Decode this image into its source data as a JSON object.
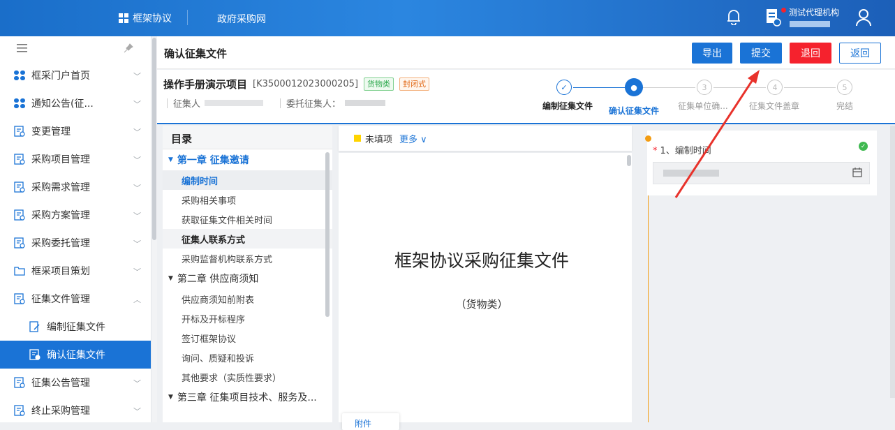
{
  "topbar": {
    "brand": "框架协议",
    "nav": "政府采购网",
    "user": "测试代理机构",
    "icons": [
      "grid-icon",
      "bell-icon",
      "document-icon",
      "user-icon"
    ]
  },
  "sidebar": {
    "items": [
      {
        "label": "框采门户首页",
        "icon": "grid-icon",
        "chevron": "﹀"
      },
      {
        "label": "通知公告(征...",
        "icon": "grid-icon",
        "chevron": "﹀"
      },
      {
        "label": "变更管理",
        "icon": "doc-list-icon",
        "chevron": "﹀"
      },
      {
        "label": "采购项目管理",
        "icon": "folder-gear-icon",
        "chevron": "﹀"
      },
      {
        "label": "采购需求管理",
        "icon": "doc-gear-icon",
        "chevron": "﹀"
      },
      {
        "label": "采购方案管理",
        "icon": "doc-gear-icon",
        "chevron": "﹀"
      },
      {
        "label": "采购委托管理",
        "icon": "doc-gear-icon",
        "chevron": "﹀"
      },
      {
        "label": "框采项目策划",
        "icon": "folder-icon",
        "chevron": "﹀"
      },
      {
        "label": "征集文件管理",
        "icon": "doc-gear-icon",
        "chevron": "︿"
      },
      {
        "label": "编制征集文件",
        "icon": "edit-doc-icon",
        "sub": true
      },
      {
        "label": "确认征集文件",
        "icon": "doc-gear-icon",
        "sub": true,
        "active": true
      },
      {
        "label": "征集公告管理",
        "icon": "doc-gear-icon",
        "chevron": "﹀"
      },
      {
        "label": "终止采购管理",
        "icon": "doc-stop-icon",
        "chevron": "﹀"
      }
    ]
  },
  "page": {
    "title": "确认征集文件",
    "buttons": {
      "export": "导出",
      "submit": "提交",
      "return": "退回",
      "back": "返回"
    }
  },
  "project": {
    "name": "操作手册演示项目",
    "code": "[K3500012023000205]",
    "tag1": "货物类",
    "tag2": "封闭式",
    "collector_label": "征集人",
    "entrusted_label": "委托征集人："
  },
  "steps": [
    {
      "num": "✓",
      "label": "编制征集文件",
      "state": "done"
    },
    {
      "num": "●",
      "label": "确认征集文件",
      "state": "current"
    },
    {
      "num": "3",
      "label": "征集单位确...",
      "state": "todo"
    },
    {
      "num": "4",
      "label": "征集文件盖章",
      "state": "todo"
    },
    {
      "num": "5",
      "label": "完结",
      "state": "todo"
    }
  ],
  "toc": {
    "header": "目录",
    "entries": [
      {
        "type": "chapter",
        "label": "第一章 征集邀请",
        "style": "blue"
      },
      {
        "type": "item",
        "label": "编制时间",
        "style": "sel"
      },
      {
        "type": "item",
        "label": "采购相关事项"
      },
      {
        "type": "item",
        "label": "获取征集文件相关时间"
      },
      {
        "type": "item",
        "label": "征集人联系方式",
        "style": "bold"
      },
      {
        "type": "item",
        "label": "采购监督机构联系方式"
      },
      {
        "type": "chapter",
        "label": "第二章 供应商须知"
      },
      {
        "type": "item",
        "label": "供应商须知前附表"
      },
      {
        "type": "item",
        "label": "开标及开标程序"
      },
      {
        "type": "item",
        "label": "签订框架协议"
      },
      {
        "type": "item",
        "label": "询问、质疑和投诉"
      },
      {
        "type": "item",
        "label": "其他要求（实质性要求）"
      },
      {
        "type": "chapter",
        "label": "第三章 征集项目技术、服务及..."
      }
    ]
  },
  "doc": {
    "filter_label": "未填项",
    "more": "更多 ∨",
    "title": "框架协议采购征集文件",
    "subtitle": "（货物类）",
    "attach": "附件"
  },
  "form": {
    "field_label": "1、编制时间",
    "required": "*"
  },
  "colors": {
    "primary": "#1a73d6",
    "danger": "#f5222d",
    "accent": "#f39c12",
    "success": "#3fb950"
  }
}
